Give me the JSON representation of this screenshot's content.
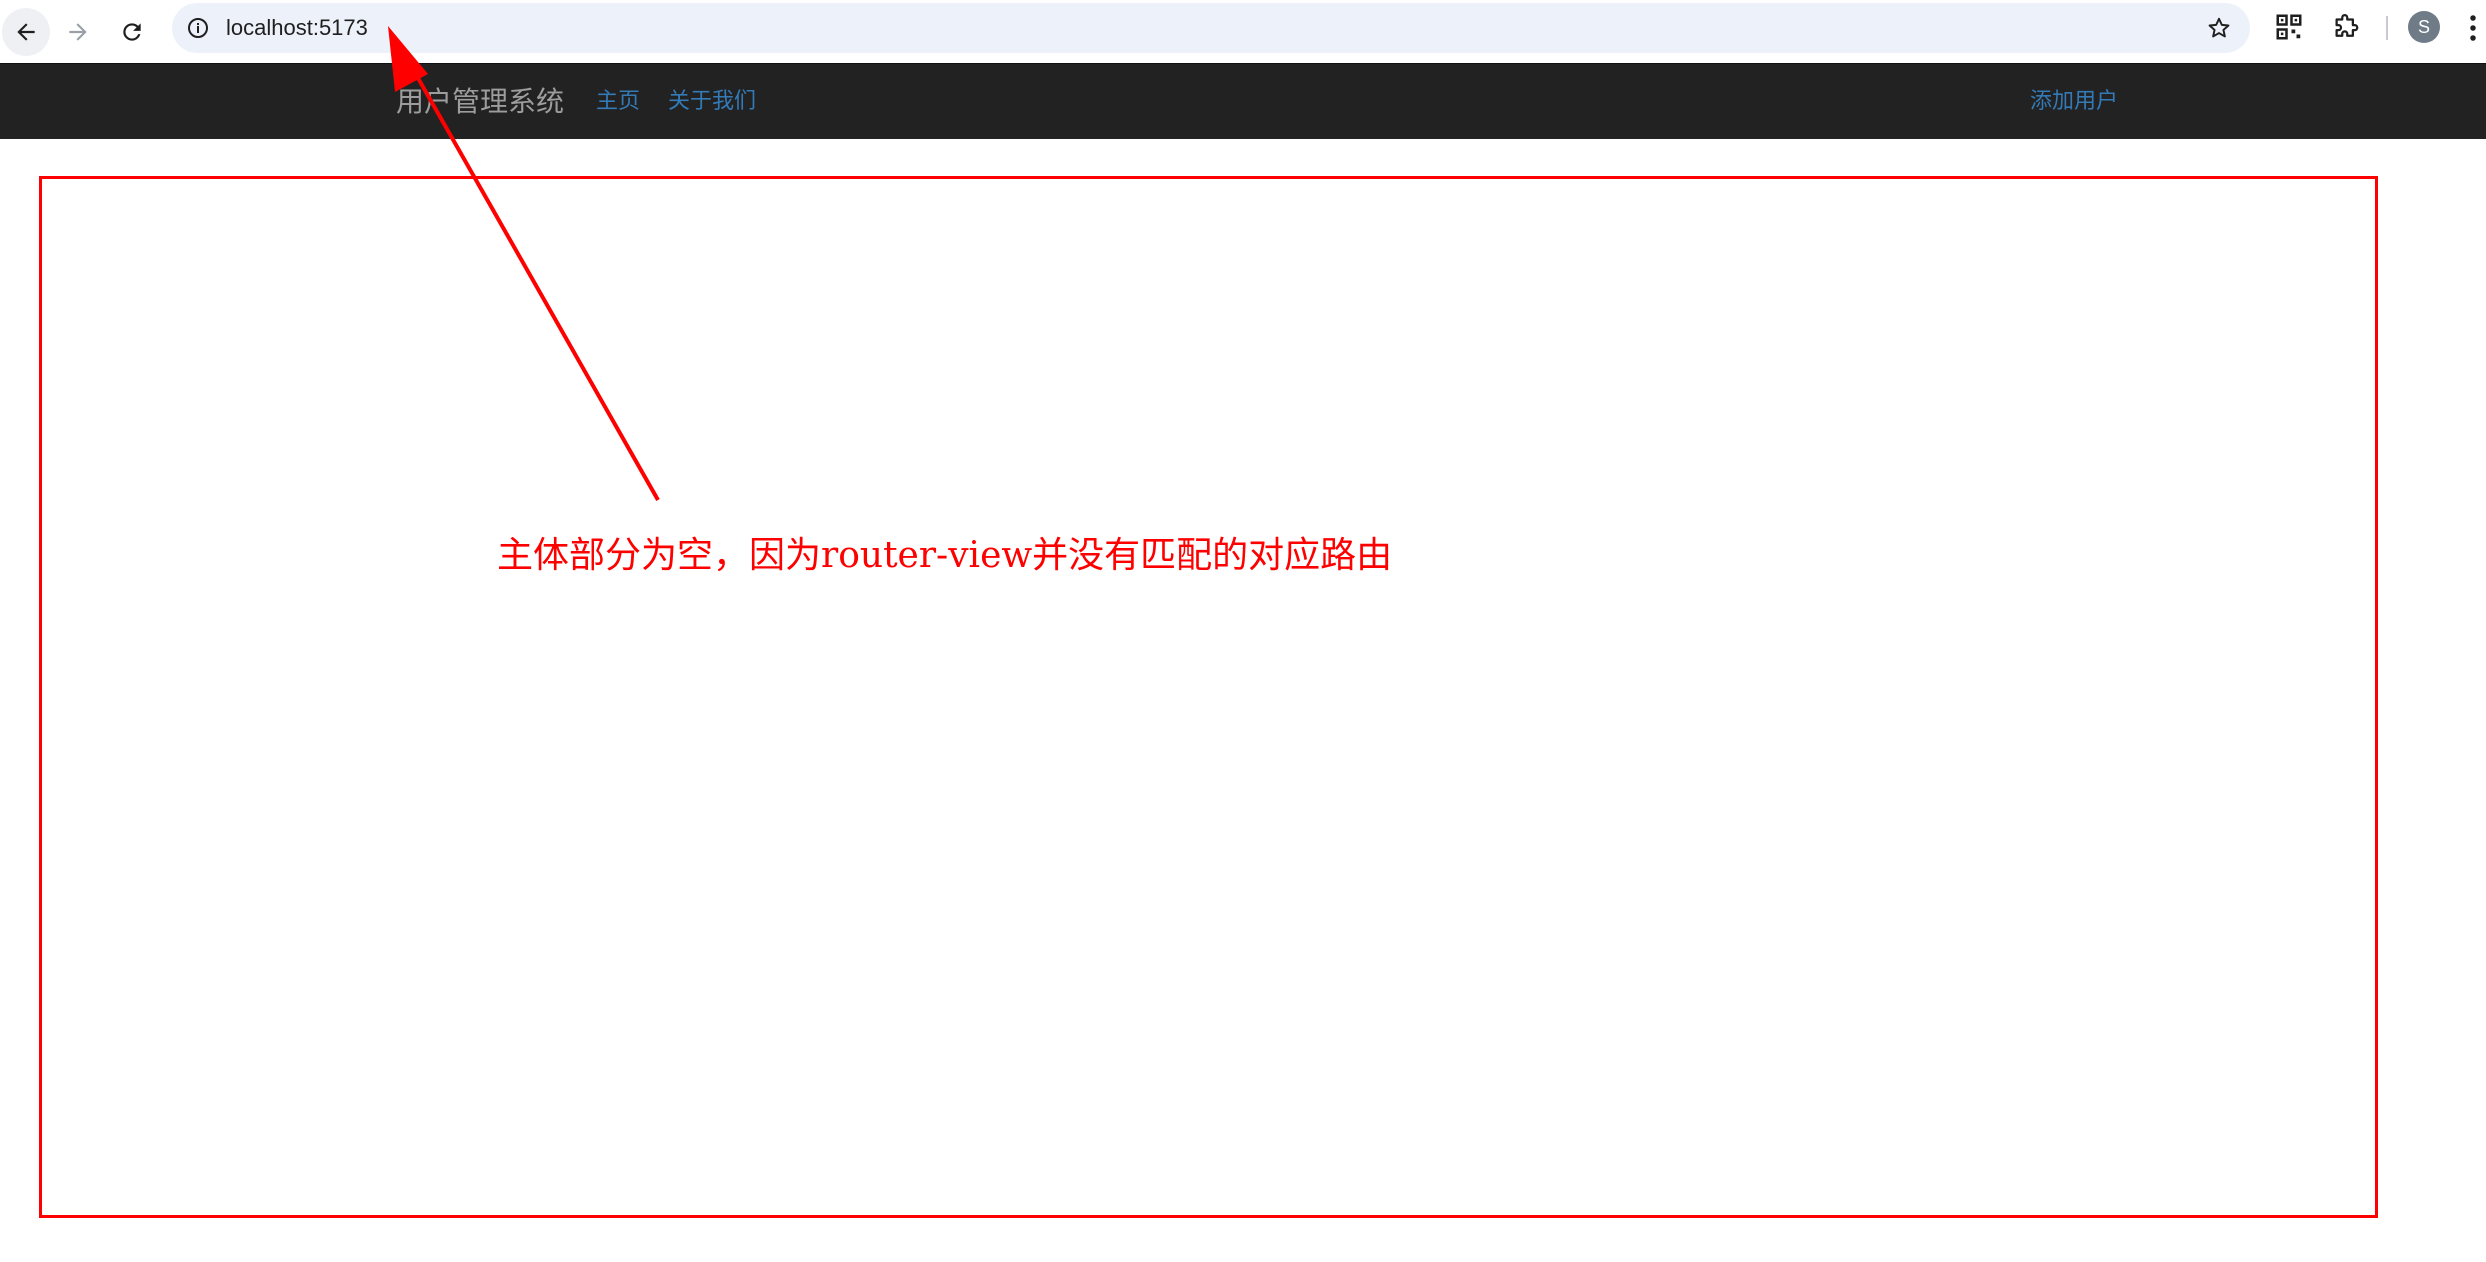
{
  "browser": {
    "url": "localhost:5173",
    "profile_initial": "S",
    "icons": {
      "back": "arrow-left-icon",
      "forward": "arrow-right-icon",
      "reload": "reload-icon",
      "site_info": "info-icon",
      "bookmark": "star-icon",
      "qr": "qr-code-icon",
      "extensions": "puzzle-icon",
      "menu": "vertical-dots-icon"
    }
  },
  "navbar": {
    "brand": "用户管理系统",
    "links": [
      "主页",
      "关于我们"
    ],
    "add_user": "添加用户"
  },
  "annotation": {
    "text": "主体部分为空，因为router-view并没有匹配的对应路由",
    "color": "#ff0000"
  },
  "colors": {
    "navbar_bg": "#222222",
    "brand_text": "#9d9d9d",
    "link": "#337ab7",
    "omnibox_bg": "#edf2fa"
  }
}
